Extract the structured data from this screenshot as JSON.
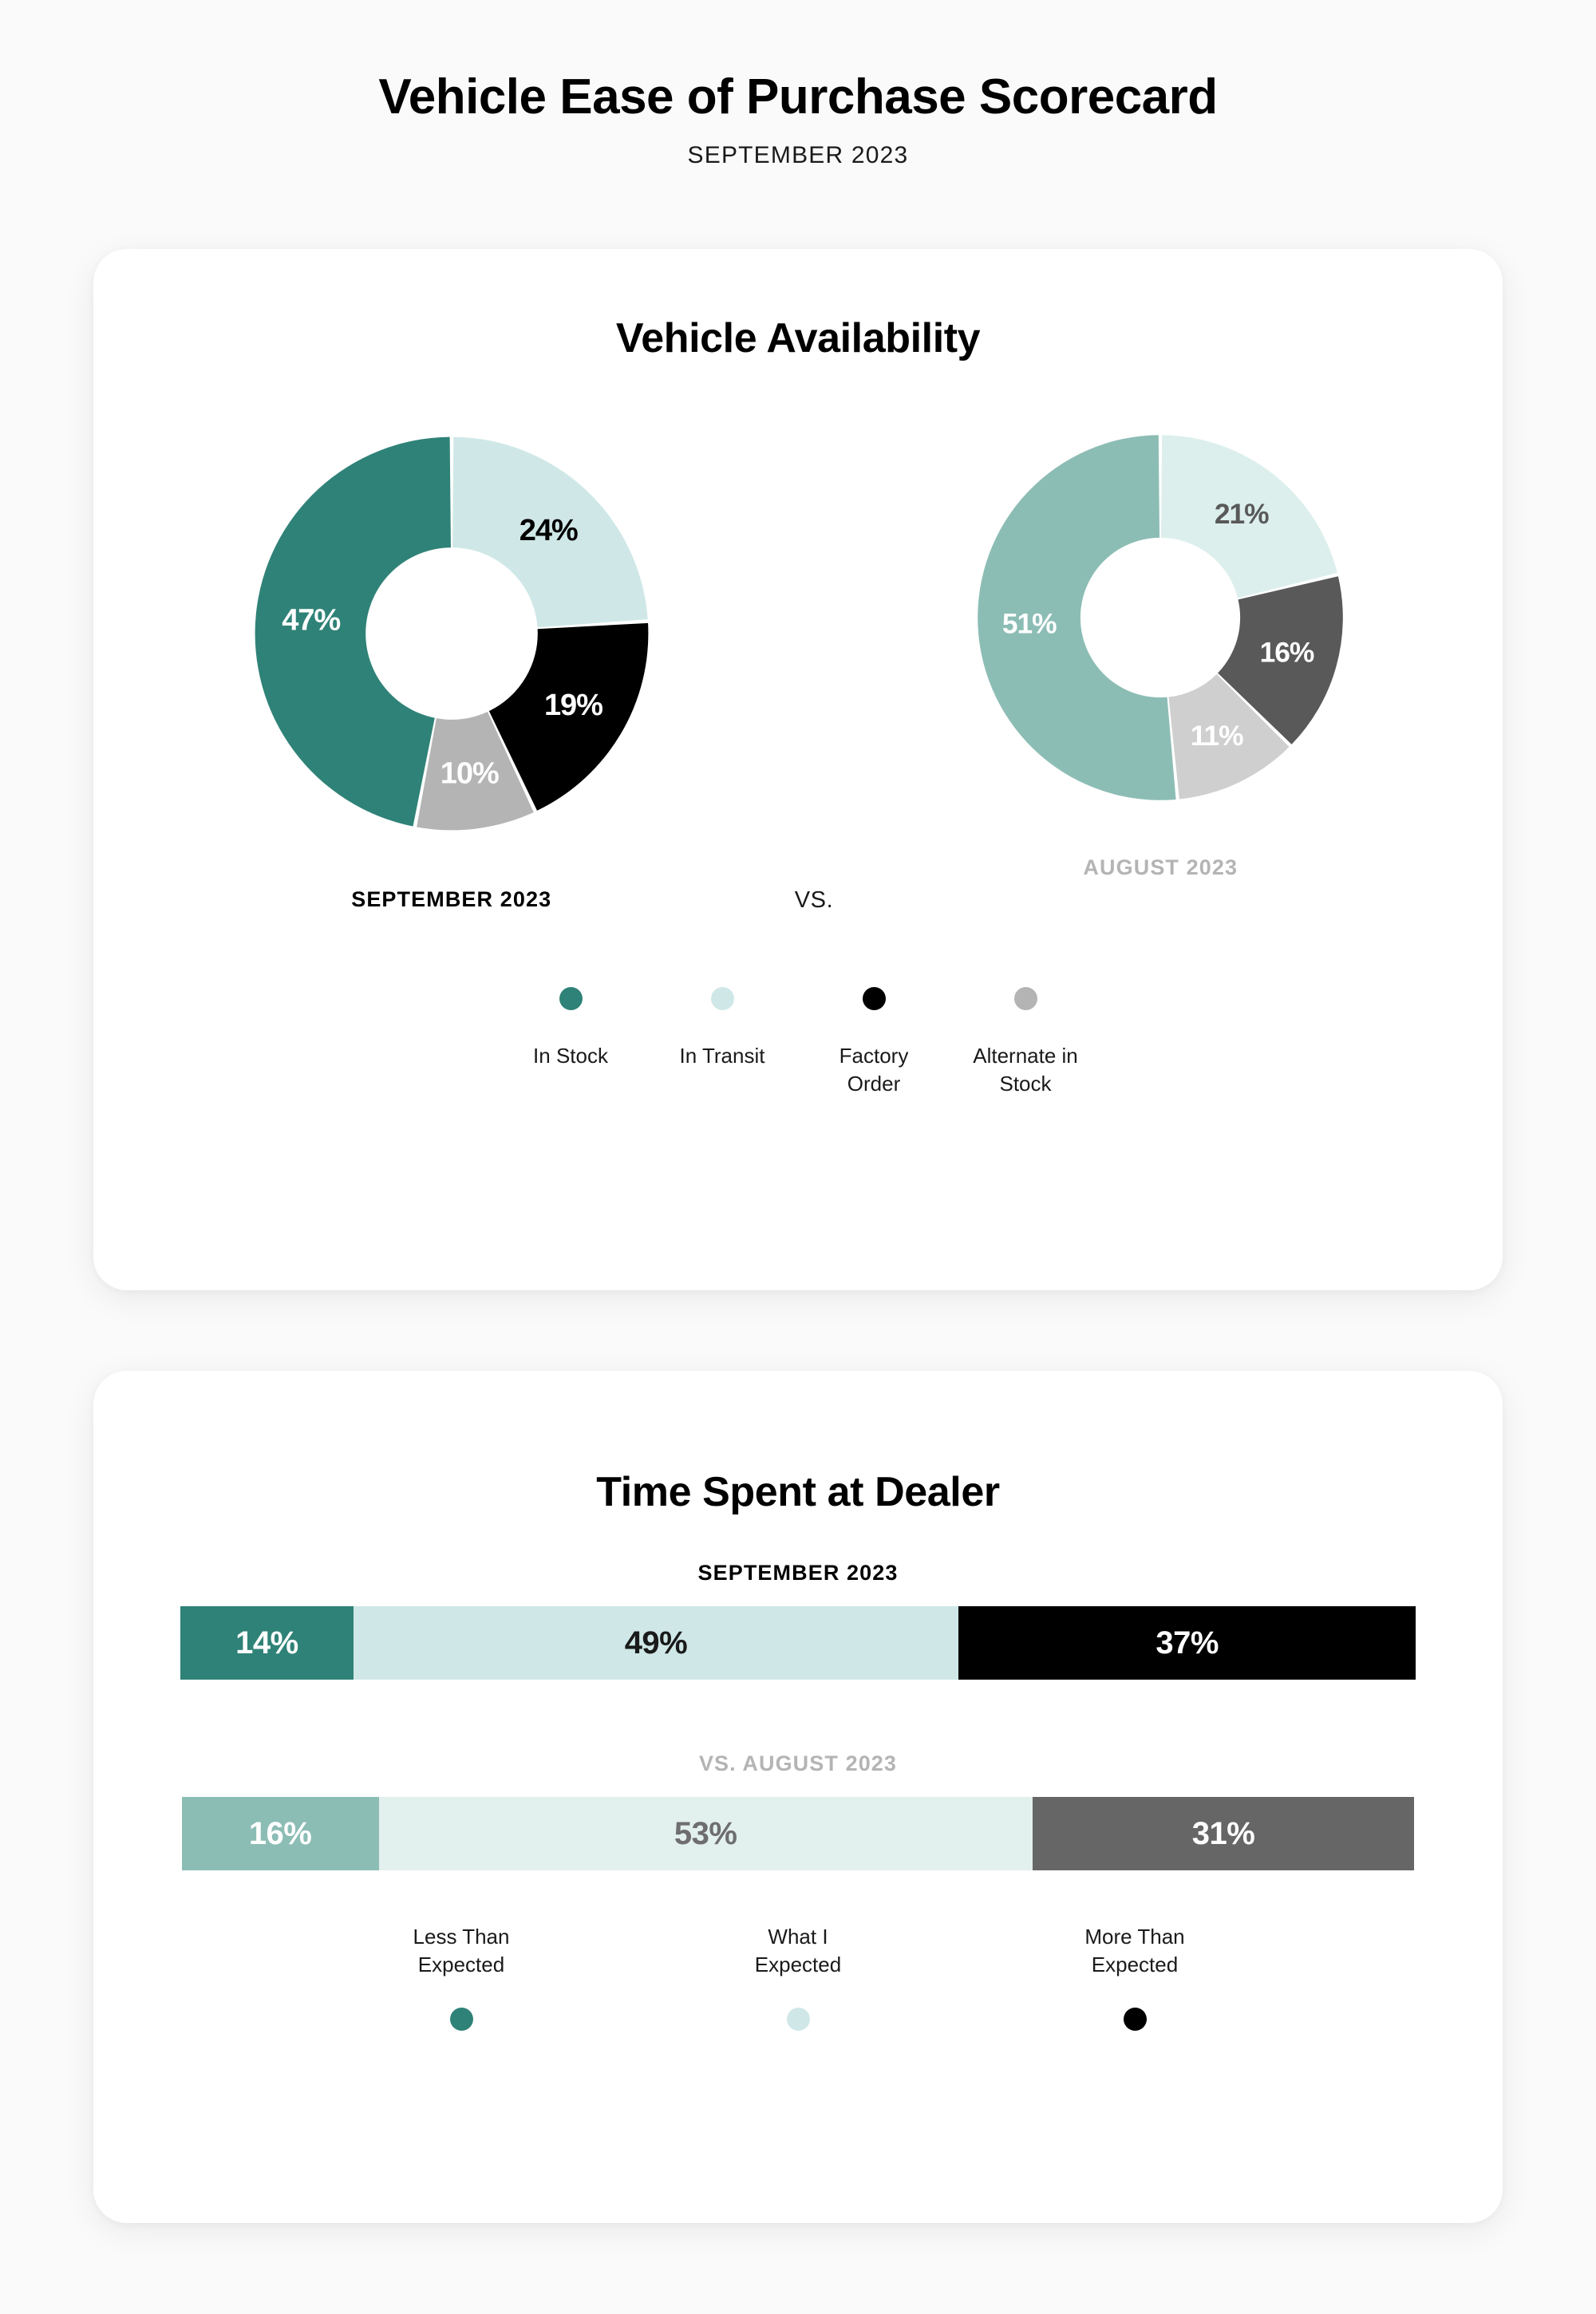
{
  "header": {
    "title": "Vehicle Ease of Purchase Scorecard",
    "subtitle": "SEPTEMBER 2023"
  },
  "colors": {
    "teal": "#2F8277",
    "mint": "#CFE8E7",
    "black": "#000000",
    "gray": "#B4B4B4",
    "teal_muted": "#8CBDB5",
    "mint_muted": "#E2F0EE",
    "dark_gray": "#595959",
    "light_gray": "#CFCFCF",
    "muted_text": "#B4B4B4",
    "page_bg": "#FAFAFA",
    "card_bg": "#FFFFFF"
  },
  "availability": {
    "title": "Vehicle Availability",
    "current_caption": "SEPTEMBER 2023",
    "vs_label": "VS.",
    "previous_caption": "AUGUST 2023",
    "legend": [
      {
        "label": "In Stock",
        "dot": "#2F8277",
        "icon": "legend-dot-icon"
      },
      {
        "label": "In Transit",
        "dot": "#CFE8E7",
        "icon": "legend-dot-icon"
      },
      {
        "label": "Factory\nOrder",
        "dot": "#000000",
        "icon": "legend-dot-icon"
      },
      {
        "label": "Alternate in\nStock",
        "dot": "#B4B4B4",
        "icon": "legend-dot-icon"
      }
    ]
  },
  "time_spent": {
    "title": "Time Spent at Dealer",
    "current_caption": "SEPTEMBER 2023",
    "previous_caption": "VS. AUGUST 2023",
    "legend": [
      {
        "label": "Less Than\nExpected",
        "dot": "#2F8277",
        "icon": "legend-dot-icon"
      },
      {
        "label": "What I\nExpected",
        "dot": "#CFE8E7",
        "icon": "legend-dot-icon"
      },
      {
        "label": "More Than\nExpected",
        "dot": "#000000",
        "icon": "legend-dot-icon"
      }
    ]
  },
  "chart_data": [
    {
      "type": "pie",
      "title": "Vehicle Availability",
      "subtitle": "SEPTEMBER 2023",
      "donut": true,
      "hole_ratio": 0.44,
      "start_angle": 0,
      "direction": "clockwise",
      "labels": [
        "In Transit",
        "Factory Order",
        "Alternate in Stock",
        "In Stock"
      ],
      "values": [
        24,
        19,
        10,
        47
      ],
      "value_labels": [
        "24%",
        "19%",
        "10%",
        "47%"
      ],
      "colors": [
        "#CFE8E7",
        "#000000",
        "#B4B4B4",
        "#2F8277"
      ],
      "label_colors": [
        "#000000",
        "#FFFFFF",
        "#FFFFFF",
        "#FFFFFF"
      ],
      "legend_position": "bottom"
    },
    {
      "type": "pie",
      "title": "Vehicle Availability",
      "subtitle": "AUGUST 2023",
      "donut": true,
      "hole_ratio": 0.44,
      "start_angle": 0,
      "direction": "clockwise",
      "labels": [
        "In Transit",
        "Factory Order",
        "Alternate in Stock",
        "In Stock"
      ],
      "values": [
        21,
        16,
        11,
        51
      ],
      "value_labels": [
        "21%",
        "16%",
        "11%",
        "51%"
      ],
      "colors": [
        "#DCEFEC",
        "#595959",
        "#CFCFCF",
        "#8CBDB5"
      ],
      "label_colors": [
        "#595959",
        "#FFFFFF",
        "#FFFFFF",
        "#FFFFFF"
      ],
      "legend_position": "bottom"
    },
    {
      "type": "bar",
      "orientation": "horizontal",
      "stacked": true,
      "title": "Time Spent at Dealer",
      "subtitle": "SEPTEMBER 2023",
      "categories": [
        "Less Than Expected",
        "What I Expected",
        "More Than Expected"
      ],
      "values": [
        14,
        49,
        37
      ],
      "value_labels": [
        "14%",
        "49%",
        "37%"
      ],
      "colors": [
        "#2F8277",
        "#CFE8E7",
        "#000000"
      ],
      "label_colors": [
        "#FFFFFF",
        "#1A1A1A",
        "#FFFFFF"
      ],
      "xlim": [
        0,
        100
      ],
      "grid": false,
      "legend_position": "bottom"
    },
    {
      "type": "bar",
      "orientation": "horizontal",
      "stacked": true,
      "title": "Time Spent at Dealer",
      "subtitle": "VS. AUGUST 2023",
      "categories": [
        "Less Than Expected",
        "What I Expected",
        "More Than Expected"
      ],
      "values": [
        16,
        53,
        31
      ],
      "value_labels": [
        "16%",
        "53%",
        "31%"
      ],
      "colors": [
        "#8CBDB5",
        "#E2F0EE",
        "#666666"
      ],
      "label_colors": [
        "#FFFFFF",
        "#6E6E6E",
        "#FFFFFF"
      ],
      "xlim": [
        0,
        100
      ],
      "grid": false,
      "legend_position": "bottom"
    }
  ]
}
